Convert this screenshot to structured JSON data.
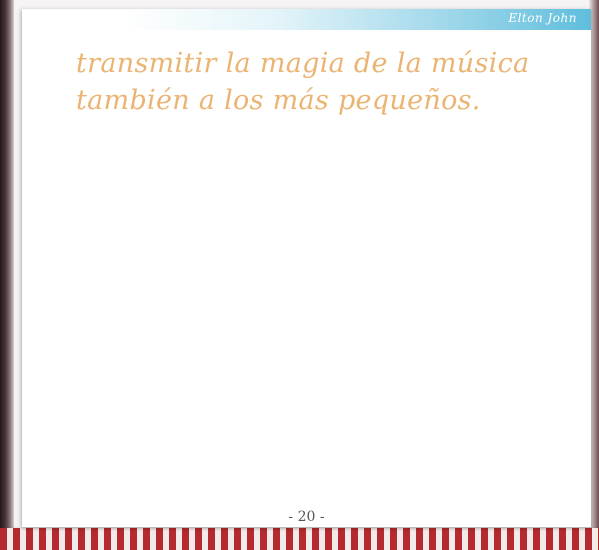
{
  "header": {
    "author": "Elton John"
  },
  "body": {
    "lines": [
      "transmitir la magia de la música",
      "también a los más pequeños."
    ]
  },
  "footer": {
    "page_number": "- 20 -"
  },
  "colors": {
    "body_text": "#ebb472",
    "header_accent": "#5fbedd",
    "strip_red": "#b52a2f"
  }
}
